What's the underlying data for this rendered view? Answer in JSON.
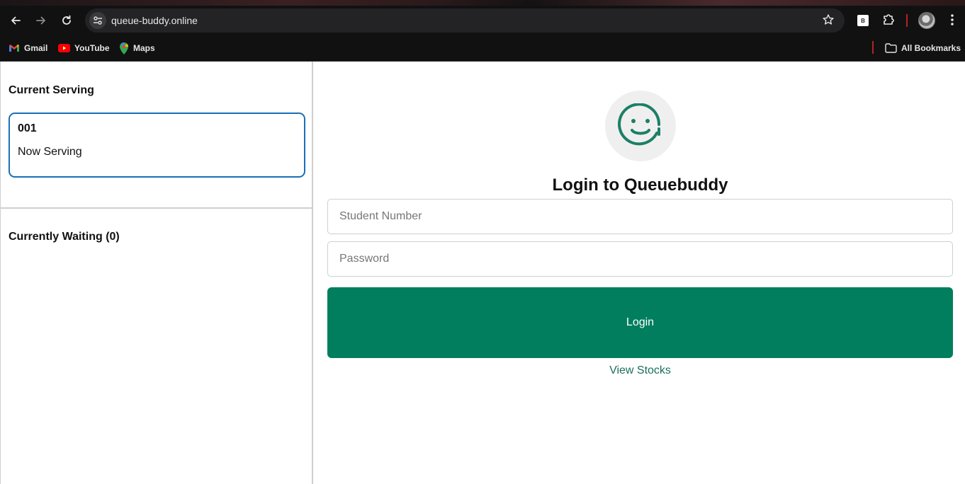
{
  "browser": {
    "url": "queue-buddy.online",
    "extension_label": "B",
    "bookmarks": [
      {
        "label": "Gmail",
        "icon": "gmail-icon"
      },
      {
        "label": "YouTube",
        "icon": "youtube-icon"
      },
      {
        "label": "Maps",
        "icon": "maps-icon"
      }
    ],
    "all_bookmarks_label": "All Bookmarks"
  },
  "sidebar": {
    "current_serving_title": "Current Serving",
    "serving_number": "001",
    "serving_status": "Now Serving",
    "waiting_title": "Currently Waiting (0)"
  },
  "login": {
    "logo_icon": "smiley-icon",
    "title": "Login to Queuebuddy",
    "student_number_placeholder": "Student Number",
    "password_placeholder": "Password",
    "button_label": "Login",
    "view_stocks_label": "View Stocks"
  },
  "colors": {
    "accent": "#007e5d",
    "card_border": "#1a6fb8",
    "link": "#1b6f5a"
  }
}
